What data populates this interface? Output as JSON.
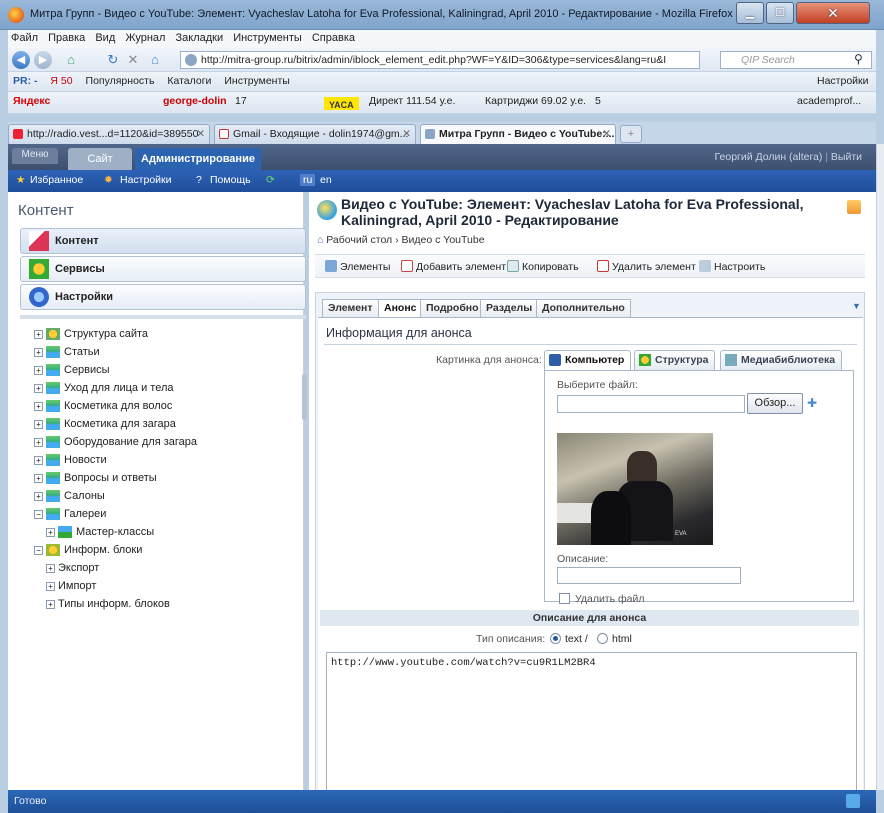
{
  "window": {
    "title": "Митра Групп - Видео с YouTube: Элемент: Vyacheslav Latoha for Eva Professional, Kaliningrad, April 2010 - Редактирование - Mozilla Firefox"
  },
  "menubar": [
    "Файл",
    "Правка",
    "Вид",
    "Журнал",
    "Закладки",
    "Инструменты",
    "Справка"
  ],
  "navbar": {
    "url": "http://mitra-group.ru/bitrix/admin/iblock_element_edit.php?WF=Y&ID=306&type=services&lang=ru&I",
    "search_placeholder": "QIP Search"
  },
  "bookmarks1": {
    "pr": "PR: -",
    "ya": "Я 50",
    "popular": "Популярность",
    "catalogs": "Каталоги",
    "tools": "Инструменты",
    "settings": "Настройки"
  },
  "bookmarks2": {
    "yandex": "Яндекс",
    "user": "george-dolin",
    "mail": "17",
    "yaca": "YACA",
    "direct": "Директ 111.54 у.е.",
    "cartridges": "Картриджи 69.02 у.е.",
    "count": "5",
    "academ": "academprof..."
  },
  "tabs": [
    {
      "label": "http://radio.vest...d=1120&id=389550"
    },
    {
      "label": "Gmail - Входящие - dolin1974@gm..."
    },
    {
      "label": "Митра Групп - Видео с YouTube:..."
    }
  ],
  "admin": {
    "menu": "Меню",
    "site": "Сайт",
    "administration": "Администрирование",
    "user": "Георгий Долин (altera)",
    "logout": "Выйти",
    "favorites": "Избранное",
    "settings": "Настройки",
    "help": "Помощь",
    "lang_ru": "ru",
    "lang_en": "en"
  },
  "left": {
    "title": "Контент",
    "buttons": [
      "Контент",
      "Сервисы",
      "Настройки"
    ],
    "tree": [
      {
        "label": "Структура сайта",
        "level": 0,
        "sign": "+"
      },
      {
        "label": "Статьи",
        "level": 0,
        "sign": "+"
      },
      {
        "label": "Сервисы",
        "level": 0,
        "sign": "+"
      },
      {
        "label": "Уход для лица и тела",
        "level": 0,
        "sign": "+"
      },
      {
        "label": "Косметика для волос",
        "level": 0,
        "sign": "+"
      },
      {
        "label": "Косметика для загара",
        "level": 0,
        "sign": "+"
      },
      {
        "label": "Оборудование для загара",
        "level": 0,
        "sign": "+"
      },
      {
        "label": "Новости",
        "level": 0,
        "sign": "+"
      },
      {
        "label": "Вопросы и ответы",
        "level": 0,
        "sign": "+"
      },
      {
        "label": "Салоны",
        "level": 0,
        "sign": "+"
      },
      {
        "label": "Галереи",
        "level": 0,
        "sign": "−"
      },
      {
        "label": "Мастер-классы",
        "level": 1,
        "sign": "+"
      },
      {
        "label": "Информ. блоки",
        "level": 0,
        "sign": "−"
      },
      {
        "label": "Экспорт",
        "level": 1,
        "sign": "+"
      },
      {
        "label": "Импорт",
        "level": 1,
        "sign": "+"
      },
      {
        "label": "Типы информ. блоков",
        "level": 1,
        "sign": "+"
      }
    ]
  },
  "page": {
    "title": "Видео с YouTube: Элемент: Vyacheslav Latoha for Eva Professional, Kaliningrad, April 2010 - Редактирование",
    "breadcrumb_home": "Рабочий стол",
    "breadcrumb_sep": "›",
    "breadcrumb_current": "Видео с YouTube",
    "toolbar": {
      "elements": "Элементы",
      "add": "Добавить элемент",
      "copy": "Копировать",
      "delete": "Удалить элемент",
      "settings": "Настроить"
    },
    "form_tabs": [
      "Элемент",
      "Анонс",
      "Подробно",
      "Разделы",
      "Дополнительно"
    ],
    "section_title": "Информация для анонса",
    "picture_label": "Картинка для анонса:",
    "picker_tabs": [
      "Компьютер",
      "Структура",
      "Медиабиблиотека"
    ],
    "choose_file": "Выберите файл:",
    "browse": "Обзор...",
    "photo_logo": "EVA",
    "description_label": "Описание:",
    "delete_file": "Удалить файл",
    "announce_desc_header": "Описание для анонса",
    "desc_type_label": "Тип описания:",
    "type_text": "text",
    "type_sep": "/",
    "type_html": "html",
    "announce_text": "http://www.youtube.com/watch?v=cu9R1LM2BR4"
  },
  "status": {
    "text": "Готово"
  }
}
